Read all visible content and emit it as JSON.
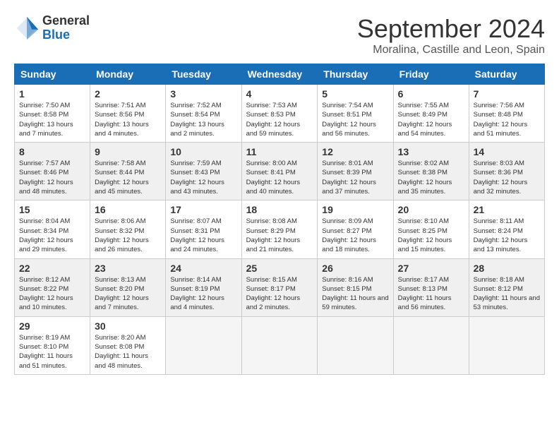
{
  "logo": {
    "general": "General",
    "blue": "Blue"
  },
  "title": "September 2024",
  "subtitle": "Moralina, Castille and Leon, Spain",
  "days_header": [
    "Sunday",
    "Monday",
    "Tuesday",
    "Wednesday",
    "Thursday",
    "Friday",
    "Saturday"
  ],
  "weeks": [
    [
      {
        "day": "1",
        "info": "Sunrise: 7:50 AM\nSunset: 8:58 PM\nDaylight: 13 hours and 7 minutes."
      },
      {
        "day": "2",
        "info": "Sunrise: 7:51 AM\nSunset: 8:56 PM\nDaylight: 13 hours and 4 minutes."
      },
      {
        "day": "3",
        "info": "Sunrise: 7:52 AM\nSunset: 8:54 PM\nDaylight: 13 hours and 2 minutes."
      },
      {
        "day": "4",
        "info": "Sunrise: 7:53 AM\nSunset: 8:53 PM\nDaylight: 12 hours and 59 minutes."
      },
      {
        "day": "5",
        "info": "Sunrise: 7:54 AM\nSunset: 8:51 PM\nDaylight: 12 hours and 56 minutes."
      },
      {
        "day": "6",
        "info": "Sunrise: 7:55 AM\nSunset: 8:49 PM\nDaylight: 12 hours and 54 minutes."
      },
      {
        "day": "7",
        "info": "Sunrise: 7:56 AM\nSunset: 8:48 PM\nDaylight: 12 hours and 51 minutes."
      }
    ],
    [
      {
        "day": "8",
        "info": "Sunrise: 7:57 AM\nSunset: 8:46 PM\nDaylight: 12 hours and 48 minutes."
      },
      {
        "day": "9",
        "info": "Sunrise: 7:58 AM\nSunset: 8:44 PM\nDaylight: 12 hours and 45 minutes."
      },
      {
        "day": "10",
        "info": "Sunrise: 7:59 AM\nSunset: 8:43 PM\nDaylight: 12 hours and 43 minutes."
      },
      {
        "day": "11",
        "info": "Sunrise: 8:00 AM\nSunset: 8:41 PM\nDaylight: 12 hours and 40 minutes."
      },
      {
        "day": "12",
        "info": "Sunrise: 8:01 AM\nSunset: 8:39 PM\nDaylight: 12 hours and 37 minutes."
      },
      {
        "day": "13",
        "info": "Sunrise: 8:02 AM\nSunset: 8:38 PM\nDaylight: 12 hours and 35 minutes."
      },
      {
        "day": "14",
        "info": "Sunrise: 8:03 AM\nSunset: 8:36 PM\nDaylight: 12 hours and 32 minutes."
      }
    ],
    [
      {
        "day": "15",
        "info": "Sunrise: 8:04 AM\nSunset: 8:34 PM\nDaylight: 12 hours and 29 minutes."
      },
      {
        "day": "16",
        "info": "Sunrise: 8:06 AM\nSunset: 8:32 PM\nDaylight: 12 hours and 26 minutes."
      },
      {
        "day": "17",
        "info": "Sunrise: 8:07 AM\nSunset: 8:31 PM\nDaylight: 12 hours and 24 minutes."
      },
      {
        "day": "18",
        "info": "Sunrise: 8:08 AM\nSunset: 8:29 PM\nDaylight: 12 hours and 21 minutes."
      },
      {
        "day": "19",
        "info": "Sunrise: 8:09 AM\nSunset: 8:27 PM\nDaylight: 12 hours and 18 minutes."
      },
      {
        "day": "20",
        "info": "Sunrise: 8:10 AM\nSunset: 8:25 PM\nDaylight: 12 hours and 15 minutes."
      },
      {
        "day": "21",
        "info": "Sunrise: 8:11 AM\nSunset: 8:24 PM\nDaylight: 12 hours and 13 minutes."
      }
    ],
    [
      {
        "day": "22",
        "info": "Sunrise: 8:12 AM\nSunset: 8:22 PM\nDaylight: 12 hours and 10 minutes."
      },
      {
        "day": "23",
        "info": "Sunrise: 8:13 AM\nSunset: 8:20 PM\nDaylight: 12 hours and 7 minutes."
      },
      {
        "day": "24",
        "info": "Sunrise: 8:14 AM\nSunset: 8:19 PM\nDaylight: 12 hours and 4 minutes."
      },
      {
        "day": "25",
        "info": "Sunrise: 8:15 AM\nSunset: 8:17 PM\nDaylight: 12 hours and 2 minutes."
      },
      {
        "day": "26",
        "info": "Sunrise: 8:16 AM\nSunset: 8:15 PM\nDaylight: 11 hours and 59 minutes."
      },
      {
        "day": "27",
        "info": "Sunrise: 8:17 AM\nSunset: 8:13 PM\nDaylight: 11 hours and 56 minutes."
      },
      {
        "day": "28",
        "info": "Sunrise: 8:18 AM\nSunset: 8:12 PM\nDaylight: 11 hours and 53 minutes."
      }
    ],
    [
      {
        "day": "29",
        "info": "Sunrise: 8:19 AM\nSunset: 8:10 PM\nDaylight: 11 hours and 51 minutes."
      },
      {
        "day": "30",
        "info": "Sunrise: 8:20 AM\nSunset: 8:08 PM\nDaylight: 11 hours and 48 minutes."
      },
      {
        "day": "",
        "info": ""
      },
      {
        "day": "",
        "info": ""
      },
      {
        "day": "",
        "info": ""
      },
      {
        "day": "",
        "info": ""
      },
      {
        "day": "",
        "info": ""
      }
    ]
  ]
}
